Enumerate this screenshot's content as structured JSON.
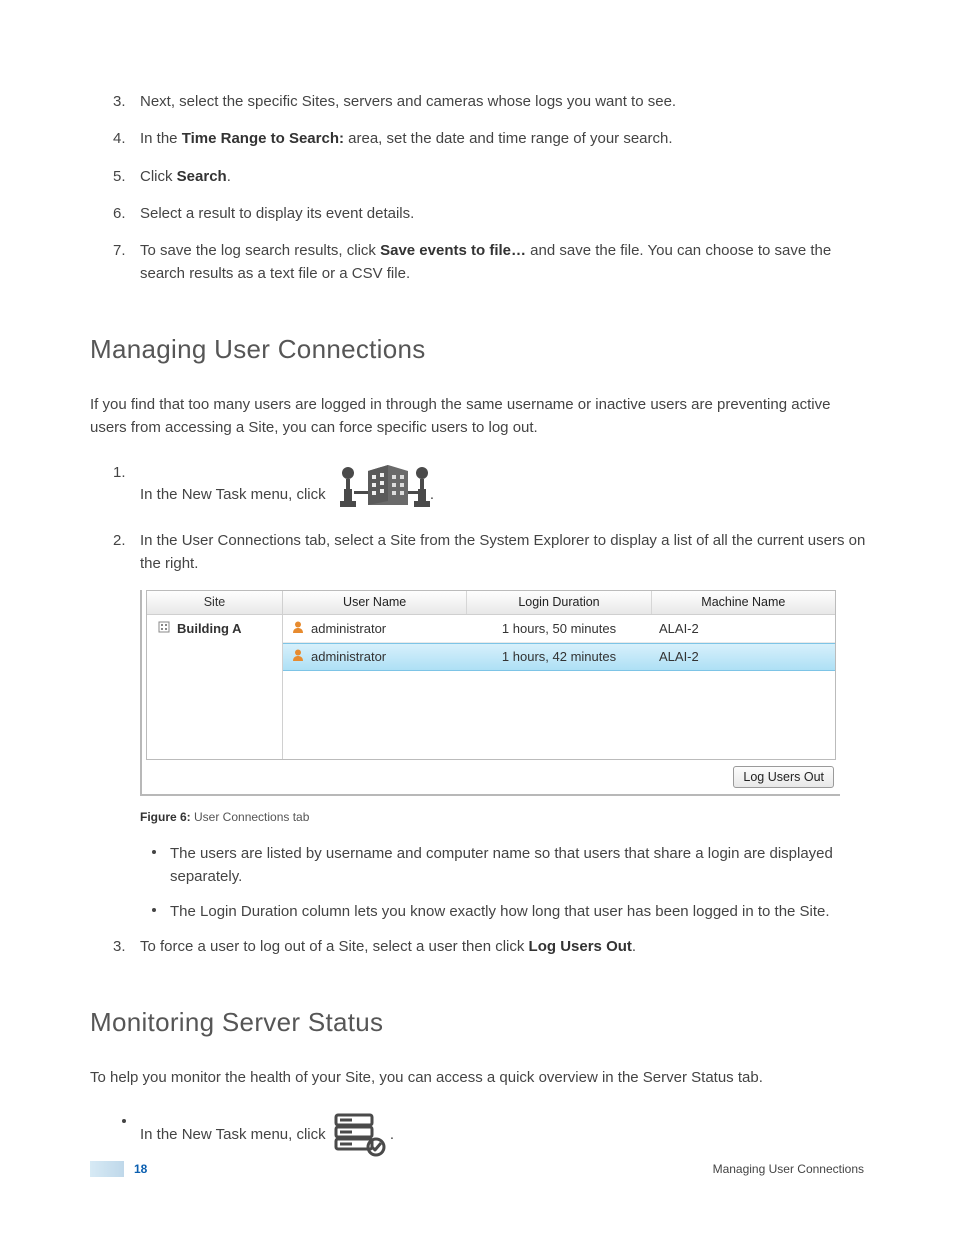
{
  "steps_top": [
    {
      "num": "3.",
      "pre": "Next, select the specific Sites, servers and cameras whose logs you want to see."
    },
    {
      "num": "4.",
      "pre": "In the ",
      "bold": "Time Range to Search:",
      "post": " area, set the date and time range of your search."
    },
    {
      "num": "5.",
      "pre": "Click ",
      "bold": "Search",
      "post": "."
    },
    {
      "num": "6.",
      "pre": "Select a result to display its event details."
    },
    {
      "num": "7.",
      "pre": "To save the log search results, click ",
      "bold": "Save events to file…",
      "post": " and save the file. You can choose to save the search results as a text file or a CSV file."
    }
  ],
  "h2_manage": "Managing User Connections",
  "p_manage": "If you find that too many users are logged in through the same username or inactive users are preventing active users from accessing a Site, you can force specific users to log out.",
  "steps_manage": [
    {
      "num": "1.",
      "pre": "In the New Task menu, click ",
      "post": "."
    },
    {
      "num": "2.",
      "pre": "In the User Connections tab, select a Site from the System Explorer to display a list of all the current users on the right."
    }
  ],
  "uc": {
    "headers": {
      "site": "Site",
      "user": "User Name",
      "duration": "Login Duration",
      "machine": "Machine Name"
    },
    "site_item": "Building A",
    "rows": [
      {
        "user": "administrator",
        "duration": "1 hours, 50 minutes",
        "machine": "ALAI-2",
        "selected": false
      },
      {
        "user": "administrator",
        "duration": "1 hours, 42 minutes",
        "machine": "ALAI-2",
        "selected": true
      }
    ],
    "button": "Log Users Out"
  },
  "fig_caption_bold": "Figure 6:",
  "fig_caption_text": " User Connections tab",
  "bullets_manage": [
    "The users are listed by username and computer name so that users that share a login are displayed separately.",
    "The Login Duration column lets you know exactly how long that user has been logged in to the Site."
  ],
  "step3_manage": {
    "num": "3.",
    "pre": "To force a user to log out of a Site, select a user then click ",
    "bold": "Log Users Out",
    "post": "."
  },
  "h2_monitor": "Monitoring Server Status",
  "p_monitor": "To help you monitor the health of your Site, you can access a quick overview in the Server Status tab.",
  "bullet_monitor": {
    "pre": "In the New Task menu, click ",
    "post": "."
  },
  "footer": {
    "page": "18",
    "title": "Managing User Connections"
  }
}
